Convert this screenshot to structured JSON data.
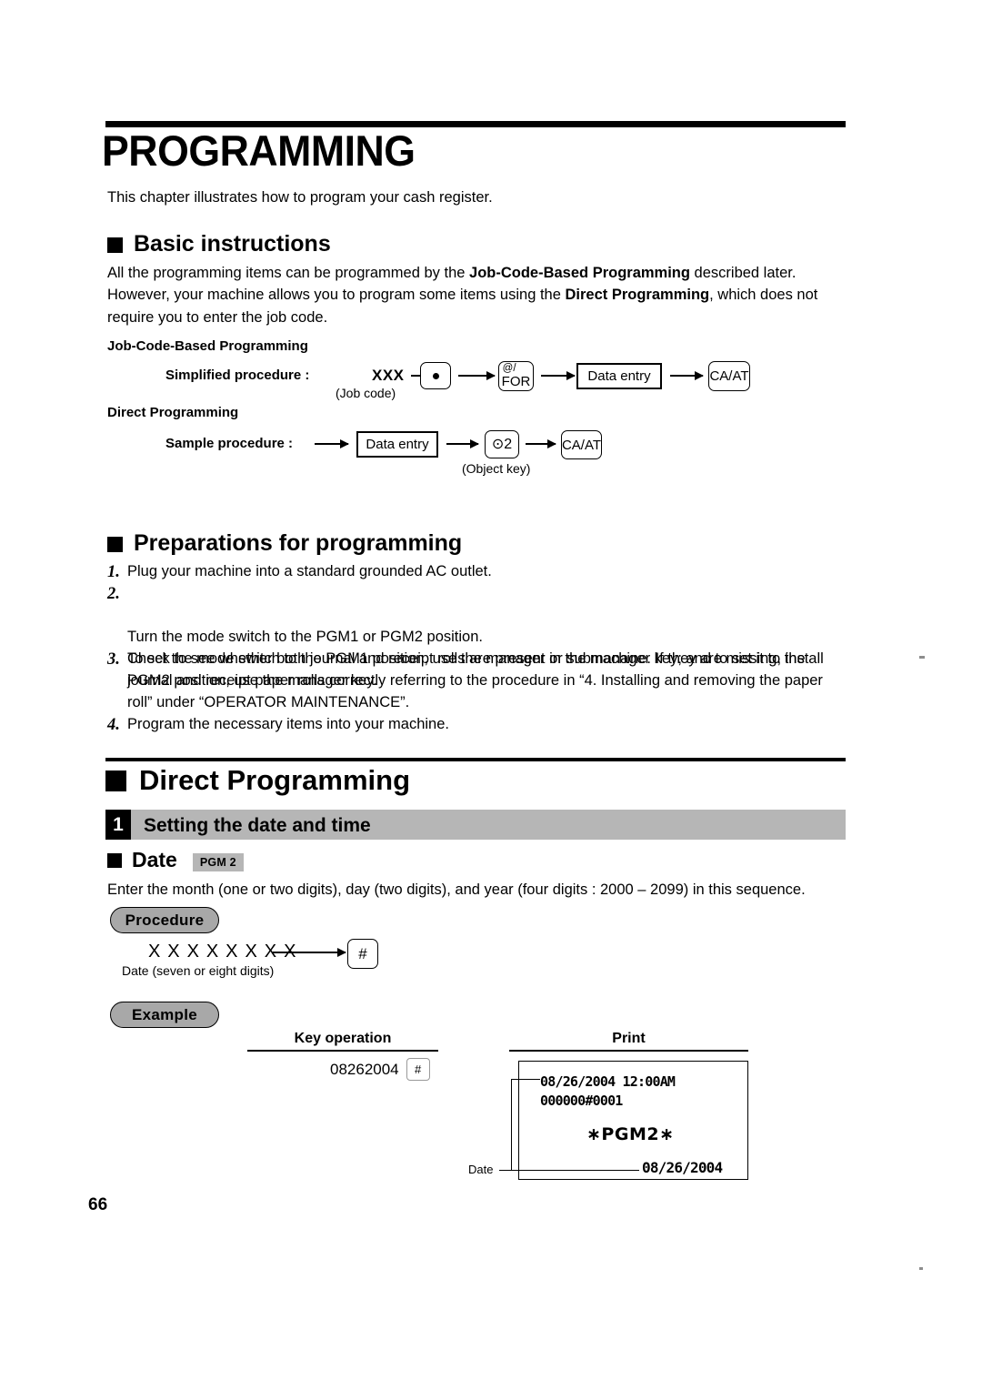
{
  "page": {
    "number": "66",
    "chapter_title": "PROGRAMMING",
    "intro": "This chapter illustrates how to program your cash register."
  },
  "basic_instructions": {
    "heading": "Basic instructions",
    "paragraph_part1": "All the programming items can be programmed by the ",
    "paragraph_bold1": "Job-Code-Based Programming",
    "paragraph_part2": " described later. However, your machine allows you to program some items using the ",
    "paragraph_bold2": "Direct Programming",
    "paragraph_part3": ", which does not require you to enter the job code."
  },
  "diagram": {
    "job_code_based_label": "Job-Code-Based Programming",
    "simplified_label": "Simplified procedure :",
    "job_code_value": "XXX",
    "job_code_caption": "(Job code)",
    "key_dot": "•",
    "key_at_top": "@/",
    "key_at_bottom": "FOR",
    "key_data_entry": "Data entry",
    "key_caat": "CA/AT",
    "direct_label": "Direct Programming",
    "sample_label": "Sample procedure :",
    "sample_data_entry": "Data entry",
    "sample_object_key": "⊙2",
    "object_key_caption": "(Object key)",
    "sample_caat": "CA/AT"
  },
  "preparations": {
    "heading": "Preparations for programming",
    "items": [
      {
        "n": "1.",
        "text": "Plug your machine into a standard grounded AC outlet."
      },
      {
        "n": "2.",
        "text": "Turn the mode switch to the PGM1 or PGM2 position.\nTo set the mode switch to the PGM1 position, use the manager or submanager key; and to set it to the PGM2 position, use the manager key."
      },
      {
        "n": "3.",
        "text": "Check to see whether both journal and receipt rolls are present in the machine. If they are missing, install journal and receipt paper rolls correctly referring to the procedure in “4. Installing and removing the paper roll” under “OPERATOR MAINTENANCE”."
      },
      {
        "n": "4.",
        "text": "Program the necessary items into your machine."
      }
    ]
  },
  "direct_programming": {
    "heading": "Direct Programming",
    "section_number": "1",
    "section_title": "Setting the date and time",
    "date_heading": "Date",
    "pgm_badge": "PGM 2",
    "date_intro": "Enter the month (one or two digits), day (two digits), and year (four digits : 2000 – 2099) in this sequence."
  },
  "procedure": {
    "pill_label": "Procedure",
    "digits": "X X X X X X X X",
    "caption": "Date (seven or eight digits)",
    "key_hash": "#"
  },
  "example": {
    "pill_label": "Example",
    "col_key_operation": "Key operation",
    "col_print": "Print",
    "key_operation_value": "08262004",
    "key_operation_key": "#",
    "receipt": {
      "line1": "08/26/2004 12:00AM",
      "line2": "000000#0001",
      "mode": "∗PGM2∗",
      "date_value": "08/26/2004",
      "date_leader_label": "Date"
    }
  }
}
